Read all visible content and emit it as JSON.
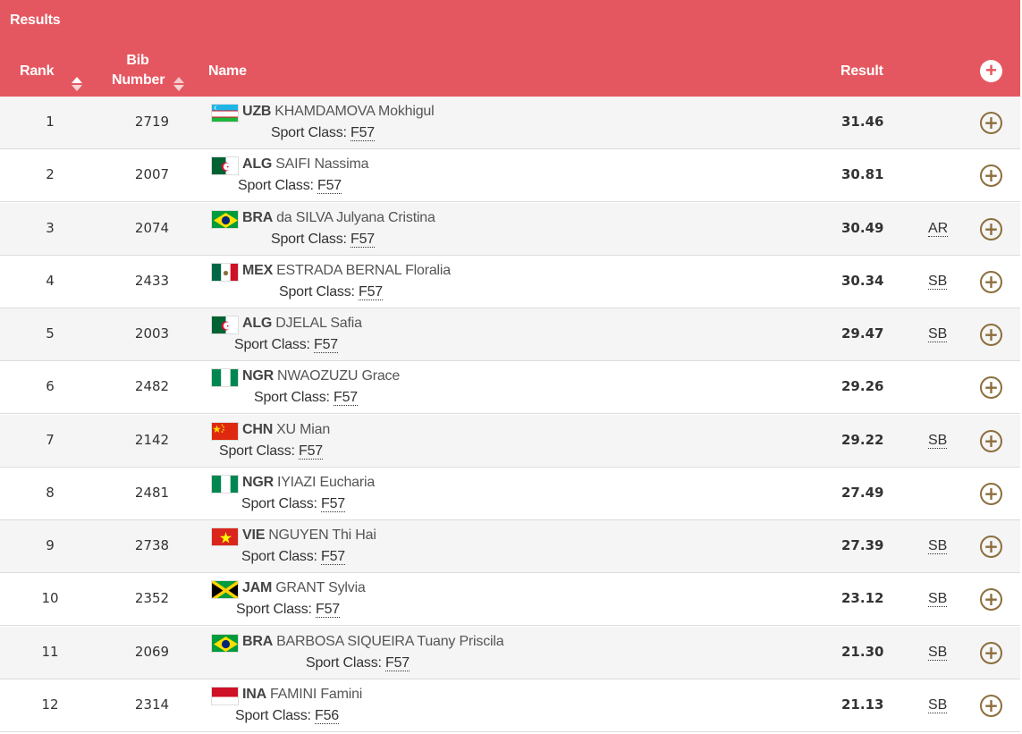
{
  "header": {
    "title": "Results",
    "col_rank": "Rank",
    "col_bib": "Bib Number",
    "col_bib_1": "Bib",
    "col_bib_2": "Number",
    "col_name": "Name",
    "col_result": "Result",
    "expand_all_icon": "plus-circle-icon"
  },
  "colors": {
    "header_bg": "#e55760",
    "plus_color": "#8c6e3c"
  },
  "sport_class_label": "Sport Class:",
  "rows": [
    {
      "rank": "1",
      "bib": "2719",
      "noc": "UZB",
      "name": "KHAMDAMOVA Mokhigul",
      "class": "F57",
      "result": "31.46",
      "record": "",
      "flag": "uzb"
    },
    {
      "rank": "2",
      "bib": "2007",
      "noc": "ALG",
      "name": "SAIFI Nassima",
      "class": "F57",
      "result": "30.81",
      "record": "",
      "flag": "alg"
    },
    {
      "rank": "3",
      "bib": "2074",
      "noc": "BRA",
      "name": "da SILVA Julyana Cristina",
      "class": "F57",
      "result": "30.49",
      "record": "AR",
      "flag": "bra"
    },
    {
      "rank": "4",
      "bib": "2433",
      "noc": "MEX",
      "name": "ESTRADA BERNAL Floralia",
      "class": "F57",
      "result": "30.34",
      "record": "SB",
      "flag": "mex"
    },
    {
      "rank": "5",
      "bib": "2003",
      "noc": "ALG",
      "name": "DJELAL Safia",
      "class": "F57",
      "result": "29.47",
      "record": "SB",
      "flag": "alg"
    },
    {
      "rank": "6",
      "bib": "2482",
      "noc": "NGR",
      "name": "NWAOZUZU Grace",
      "class": "F57",
      "result": "29.26",
      "record": "",
      "flag": "ngr"
    },
    {
      "rank": "7",
      "bib": "2142",
      "noc": "CHN",
      "name": "XU Mian",
      "class": "F57",
      "result": "29.22",
      "record": "SB",
      "flag": "chn"
    },
    {
      "rank": "8",
      "bib": "2481",
      "noc": "NGR",
      "name": "IYIAZI Eucharia",
      "class": "F57",
      "result": "27.49",
      "record": "",
      "flag": "ngr"
    },
    {
      "rank": "9",
      "bib": "2738",
      "noc": "VIE",
      "name": "NGUYEN Thi Hai",
      "class": "F57",
      "result": "27.39",
      "record": "SB",
      "flag": "vie"
    },
    {
      "rank": "10",
      "bib": "2352",
      "noc": "JAM",
      "name": "GRANT Sylvia",
      "class": "F57",
      "result": "23.12",
      "record": "SB",
      "flag": "jam"
    },
    {
      "rank": "11",
      "bib": "2069",
      "noc": "BRA",
      "name": "BARBOSA SIQUEIRA Tuany Priscila",
      "class": "F57",
      "result": "21.30",
      "record": "SB",
      "flag": "bra"
    },
    {
      "rank": "12",
      "bib": "2314",
      "noc": "INA",
      "name": "FAMINI Famini",
      "class": "F56",
      "result": "21.13",
      "record": "SB",
      "flag": "ina"
    }
  ]
}
